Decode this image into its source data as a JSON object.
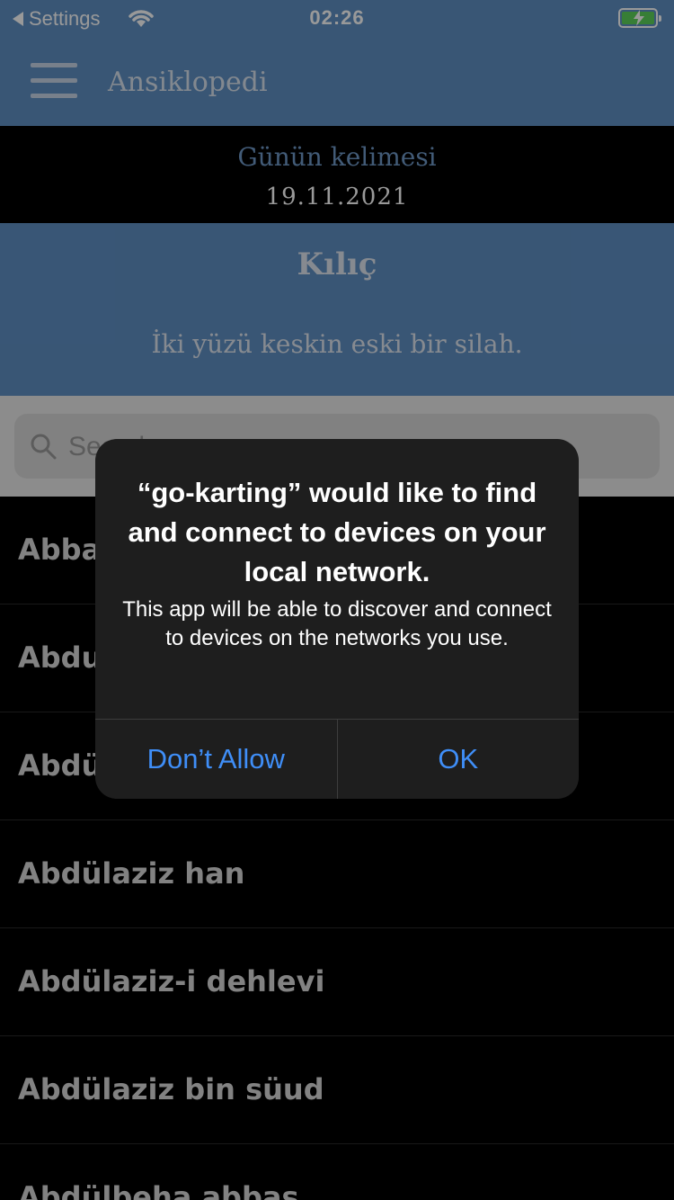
{
  "status_bar": {
    "back_label": "Settings",
    "time": "02:26"
  },
  "nav": {
    "title": "Ansiklopedi"
  },
  "word_of_day": {
    "label": "Günün kelimesi",
    "date": "19.11.2021",
    "word": "Kılıç",
    "definition": "İki yüzü keskin eski bir silah."
  },
  "search": {
    "placeholder": "Search"
  },
  "list": {
    "items": [
      "Abbas",
      "Abdullah",
      "Abdülaziz",
      "Abdülaziz han",
      "Abdülaziz-i dehlevi",
      "Abdülaziz bin süud",
      "Abdülbeha abbas"
    ]
  },
  "alert": {
    "title": "“go-karting” would like to find and connect to devices on your local network.",
    "message": "This app will be able to discover and connect to devices on the networks you use.",
    "deny_label": "Don’t Allow",
    "ok_label": "OK"
  },
  "colors": {
    "header_blue": "#5f8fc4",
    "accent_blue": "#3f8ef7",
    "battery_green": "#5dd35a"
  }
}
